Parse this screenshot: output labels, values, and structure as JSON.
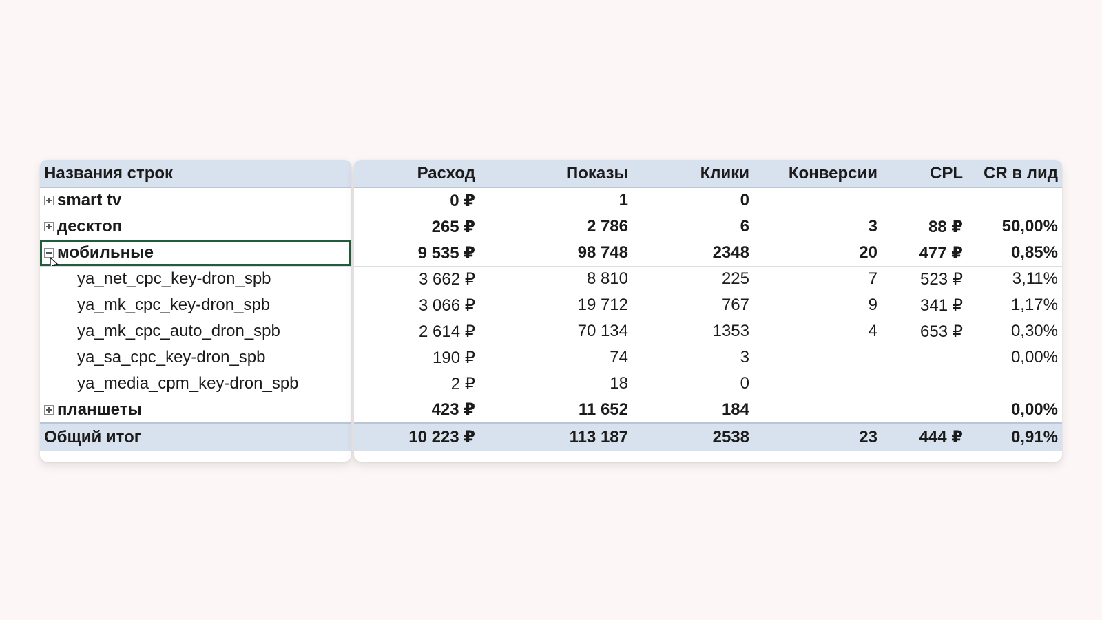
{
  "pivot": {
    "headers": {
      "row_names": "Названия строк",
      "spend": "Расход",
      "impressions": "Показы",
      "clicks": "Клики",
      "conversions": "Конверсии",
      "cpl": "CPL",
      "cr": "CR в лид"
    },
    "rows": [
      {
        "label": "smart tv",
        "spend": "0 ₽",
        "impressions": "1",
        "clicks": "0",
        "conversions": "",
        "cpl": "",
        "cr": ""
      },
      {
        "label": "десктоп",
        "spend": "265 ₽",
        "impressions": "2 786",
        "clicks": "6",
        "conversions": "3",
        "cpl": "88 ₽",
        "cr": "50,00%"
      },
      {
        "label": "мобильные",
        "spend": "9 535 ₽",
        "impressions": "98 748",
        "clicks": "2348",
        "conversions": "20",
        "cpl": "477 ₽",
        "cr": "0,85%"
      },
      {
        "label": "ya_net_cpc_key-dron_spb",
        "spend": "3 662 ₽",
        "impressions": "8 810",
        "clicks": "225",
        "conversions": "7",
        "cpl": "523 ₽",
        "cr": "3,11%"
      },
      {
        "label": "ya_mk_cpc_key-dron_spb",
        "spend": "3 066 ₽",
        "impressions": "19 712",
        "clicks": "767",
        "conversions": "9",
        "cpl": "341 ₽",
        "cr": "1,17%"
      },
      {
        "label": "ya_mk_cpc_auto_dron_spb",
        "spend": "2 614 ₽",
        "impressions": "70 134",
        "clicks": "1353",
        "conversions": "4",
        "cpl": "653 ₽",
        "cr": "0,30%"
      },
      {
        "label": "ya_sa_cpc_key-dron_spb",
        "spend": "190 ₽",
        "impressions": "74",
        "clicks": "3",
        "conversions": "",
        "cpl": "",
        "cr": "0,00%"
      },
      {
        "label": "ya_media_cpm_key-dron_spb",
        "spend": "2 ₽",
        "impressions": "18",
        "clicks": "0",
        "conversions": "",
        "cpl": "",
        "cr": ""
      },
      {
        "label": "планшеты",
        "spend": "423 ₽",
        "impressions": "11 652",
        "clicks": "184",
        "conversions": "",
        "cpl": "",
        "cr": "0,00%"
      }
    ],
    "total": {
      "label": "Общий итог",
      "spend": "10 223 ₽",
      "impressions": "113 187",
      "clicks": "2538",
      "conversions": "23",
      "cpl": "444 ₽",
      "cr": "0,91%"
    }
  },
  "icons": {
    "expand": "plus-box-icon",
    "collapse": "minus-box-icon",
    "cursor": "mouse-pointer-icon"
  }
}
